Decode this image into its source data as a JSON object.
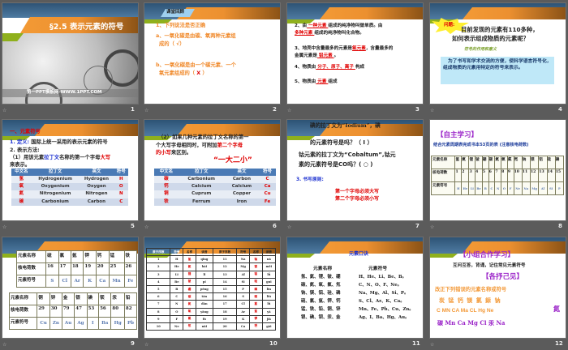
{
  "slides": [
    {
      "num": "1",
      "title": "§2.5  表示元素的符号",
      "footer": "第一PPT模板网-WWW.1PPT.COM"
    },
    {
      "num": "2",
      "tag": "课堂回顾",
      "lines": [
        [
          {
            "t": "1、下列说法是否正确",
            "c": "#f08a2c"
          }
        ],
        [
          {
            "t": "a、一氧化碳是由碳、氧两种元素组",
            "c": "#f08a2c"
          }
        ],
        [
          {
            "t": "成的（",
            "c": "#f08a2c"
          },
          {
            "t": " √",
            "c": "#f08a2c"
          },
          {
            "t": "）",
            "c": "#f08a2c"
          }
        ],
        [
          {
            "t": "b、一氧化碳是由一个碳元素、一个",
            "c": "#f08a2c"
          }
        ],
        [
          {
            "t": "氧元素组成的（",
            "c": "#f08a2c"
          },
          {
            "t": " X ",
            "c": "#e00000"
          },
          {
            "t": "）",
            "c": "#f08a2c"
          }
        ]
      ]
    },
    {
      "num": "3",
      "lines": [
        [
          {
            "t": "2、由"
          },
          {
            "t": " 一种元素 ",
            "c": "#e00000",
            "u": 1
          },
          {
            "t": "组成的纯净物叫做单质。由"
          }
        ],
        [
          {
            "t": " 多种元素 ",
            "c": "#e00000",
            "u": 1
          },
          {
            "t": "组成的纯净物叫化合物。"
          }
        ],
        [
          {
            "t": "3、地壳中含量最多的元素是"
          },
          {
            "t": "氧元素",
            "c": "#e00000",
            "u": 1
          },
          {
            "t": "，含量最多的"
          }
        ],
        [
          {
            "t": "金属元素是"
          },
          {
            "t": " 铝元素 ",
            "c": "#e00000",
            "u": 1
          },
          {
            "t": "。"
          }
        ],
        [
          {
            "t": "4、物质由"
          },
          {
            "t": " 分子、原子、离子 ",
            "c": "#e00000",
            "u": 1
          },
          {
            "t": "构成"
          }
        ],
        [
          {
            "t": "5、物质由"
          },
          {
            "t": "      元素      ",
            "c": "#e00000",
            "u": 1
          },
          {
            "t": "组成"
          }
        ]
      ]
    },
    {
      "num": "4",
      "burst": "问题:",
      "lines": [
        [
          {
            "t": "目前发现的元素有110多种，"
          }
        ],
        [
          {
            "t": "如何表示组成物质的元素呢？"
          }
        ],
        [
          {
            "t": "符号的作用和意义",
            "c": "#7aa02a"
          }
        ]
      ],
      "box": "为了书写和学术交流的方便，使科学语言符号化，组成物质的元素用特定的符号来表示。"
    },
    {
      "num": "5",
      "lines": [
        [
          {
            "t": "一、元素符号",
            "c": "#e00000"
          }
        ],
        [
          {
            "t": "1. 定义:",
            "c": "#1a2fd0"
          },
          {
            "t": " 国际上统一采用的表示元素的符号"
          }
        ],
        [
          {
            "t": "2. 表示方法:"
          }
        ],
        [
          {
            "t": "（1）用该元素"
          },
          {
            "t": "拉丁文",
            "c": "#1a2fd0"
          },
          {
            "t": "名称的第一个字母"
          },
          {
            "t": "大写",
            "c": "#e00000"
          }
        ],
        [
          {
            "t": "来表示。"
          }
        ]
      ],
      "table": {
        "headers": [
          "中文名",
          "拉丁文",
          "英文",
          "符号"
        ],
        "rows": [
          [
            "氢",
            "Hydrogenium",
            "Hydrogen",
            "H"
          ],
          [
            "氧",
            "Oxygenium",
            "Oxygen",
            "O"
          ],
          [
            "氮",
            "Nitrogenium",
            "Nitrogen",
            "N"
          ],
          [
            "碳",
            "Carbonium",
            "Carbon",
            "C"
          ]
        ]
      }
    },
    {
      "num": "6",
      "lines": [
        [
          {
            "t": "（2）如果几种元素的拉丁文名称的第一"
          }
        ],
        [
          {
            "t": "个大写字母相同时，可附加"
          },
          {
            "t": "第二个字母",
            "c": "#e00000"
          }
        ],
        [
          {
            "t": "的小写",
            "c": "#e00000"
          },
          {
            "t": "来区别。"
          }
        ],
        [
          {
            "t": "“一大二小”",
            "c": "#e00000"
          }
        ]
      ],
      "table": {
        "headers": [
          "中文名",
          "拉丁文",
          "英文",
          "符号"
        ],
        "rows": [
          [
            "碳",
            "Carbonium",
            "Carbon",
            "C"
          ],
          [
            "钙",
            "Calcium",
            "Calcium",
            "Ca"
          ],
          [
            "铜",
            "Cuprum",
            "Copper",
            "Cu"
          ],
          [
            "铁",
            "Ferrum",
            "Iron",
            "Fe"
          ]
        ]
      }
    },
    {
      "num": "7",
      "lines": [
        [
          {
            "t": "碘的拉丁文为“Iodium”，碘"
          }
        ],
        [
          {
            "t": "的元素符号是吗？（ I ）"
          }
        ],
        [
          {
            "t": "钴元素的拉丁文为“Cobaltum”,钴元"
          }
        ],
        [
          {
            "t": "素的元素符号是CO吗？( ○ )"
          }
        ],
        [
          {
            "t": "3. 书写原则:",
            "c": "#1a2fd0"
          }
        ],
        [
          {
            "t": "第一个字母必须大写",
            "c": "#e00000"
          }
        ],
        [
          {
            "t": "第二个字母必须小写",
            "c": "#e00000"
          }
        ]
      ]
    },
    {
      "num": "8",
      "title": "【自主学习】",
      "sub": "结合元素周期表完成书本53页的表 (注意核电荷数)",
      "table": [
        [
          "元素名称",
          "氢",
          "氦",
          "锂",
          "铍",
          "硼",
          "碳",
          "氮",
          "氧",
          "氟",
          "氖",
          "钠",
          "镁",
          "铝",
          "硅",
          "磷"
        ],
        [
          "核电荷数",
          "1",
          "2",
          "3",
          "4",
          "5",
          "6",
          "7",
          "8",
          "9",
          "10",
          "11",
          "12",
          "13",
          "14",
          "15"
        ],
        [
          "元素符号",
          "H",
          "He",
          "Li",
          "Be",
          "B",
          "C",
          "N",
          "O",
          "F",
          "Ne",
          "Na",
          "Mg",
          "Al",
          "Si",
          "P"
        ]
      ]
    },
    {
      "num": "9",
      "table1": [
        [
          "元素名称",
          "硫",
          "氯",
          "氩",
          "钾",
          "钙",
          "锰",
          "铁"
        ],
        [
          "核电荷数",
          "16",
          "17",
          "18",
          "19",
          "20",
          "25",
          "26"
        ],
        [
          "元素符号",
          "S",
          "Cl",
          "Ar",
          "K",
          "Ca",
          "Mn",
          "Fe"
        ]
      ],
      "table2": [
        [
          "元素名称",
          "铜",
          "锌",
          "金",
          "银",
          "碘",
          "钡",
          "汞",
          "铅"
        ],
        [
          "核电荷数",
          "29",
          "30",
          "79",
          "47",
          "53",
          "56",
          "80",
          "82"
        ],
        [
          "元素符号",
          "Cu",
          "Zn",
          "Au",
          "Ag",
          "I",
          "Ba",
          "Hg",
          "Pb"
        ]
      ]
    },
    {
      "num": "10",
      "table": [
        [
          "原子序数",
          "符号",
          "名称",
          "读音",
          "原子序数",
          "符号",
          "名称",
          "读音"
        ],
        [
          "1",
          "H",
          "氢",
          "qīng",
          "11",
          "Na",
          "钠",
          "nà"
        ],
        [
          "2",
          "He",
          "氦",
          "hài",
          "12",
          "Mg",
          "镁",
          "měi"
        ],
        [
          "3",
          "Li",
          "锂",
          "lǐ",
          "13",
          "Al",
          "铝",
          "lǚ"
        ],
        [
          "4",
          "Be",
          "铍",
          "pí",
          "14",
          "Si",
          "硅",
          "guī"
        ],
        [
          "5",
          "B",
          "硼",
          "péng",
          "15",
          "P",
          "磷",
          "lín"
        ],
        [
          "6",
          "C",
          "碳",
          "tàn",
          "16",
          "S",
          "硫",
          "liú"
        ],
        [
          "7",
          "N",
          "氮",
          "dàn",
          "17",
          "Cl",
          "氯",
          "lǜ"
        ],
        [
          "8",
          "O",
          "氧",
          "yǎng",
          "18",
          "Ar",
          "氩",
          "yà"
        ],
        [
          "9",
          "F",
          "氟",
          "fú",
          "19",
          "K",
          "钾",
          "jiǎ"
        ],
        [
          "10",
          "Ne",
          "氖",
          "nǎi",
          "20",
          "Ca",
          "钙",
          "gài"
        ]
      ]
    },
    {
      "num": "11",
      "title": "元素口诀",
      "h1": "元素名称",
      "h2": "元素符号",
      "names": [
        "氢、氦、锂、铍、硼",
        "碳、氮、氧、氟、氖",
        "钠、镁、铝、硅、磷",
        "硫、氯、氩、钾、钙",
        "锰、铁、铅、铜、锌",
        "银、碘、钡、汞、金"
      ],
      "symbols": [
        "H、He、Li、Be、B。",
        "C、N、O、F、Ne。",
        "Na、Mg、Al、Si、P。",
        "S、Cl、Ar、K、Ca。",
        "Mn、Fe、Pb、Cu、Zn。",
        "Ag、I、Ba、Hg、Au。"
      ]
    },
    {
      "num": "12",
      "title": "【小组合作学习】",
      "sub": "互问互答，背诵，记住常见元素符号",
      "title2": "【各抒己见】",
      "task": "改正下列错误的元素名称或符号",
      "chars": "炭 锰 钙 镁 氯 銾 钠",
      "wrong": "C  MN  CA  Ma  CL  Hg  Ne",
      "extra": "氮",
      "fix": "碳  Mn  Ca  Mg  Cl  汞  Na"
    }
  ],
  "colors": {
    "orange": "#f08a2c",
    "red": "#e00000",
    "blue": "#1a2fd0",
    "purple": "#9a22c8"
  }
}
